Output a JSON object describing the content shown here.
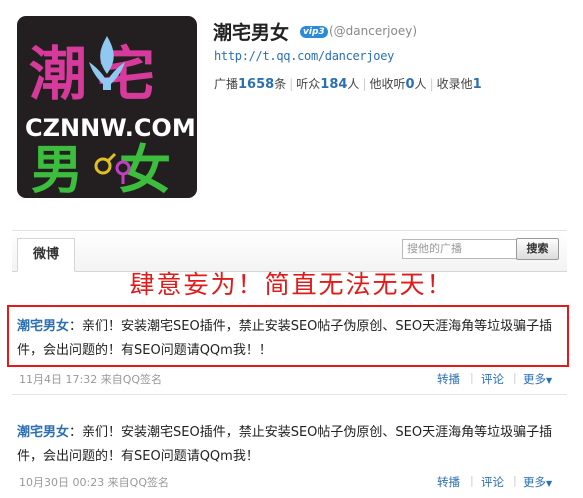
{
  "profile": {
    "name": "潮宅男女",
    "vip_badge": "vip3",
    "handle": "(@dancerjoey)",
    "url": "http://t.qq.com/dancerjoey",
    "avatar": {
      "line1": "潮宅",
      "line2": "CZNNW.COM",
      "line3": "男女"
    },
    "stats": [
      {
        "label": "广播",
        "value": "1658",
        "unit": "条"
      },
      {
        "label": "听众",
        "value": "184",
        "unit": "人"
      },
      {
        "label": "他收听",
        "value": "0",
        "unit": "人"
      },
      {
        "label": "收录他",
        "value": "1",
        "unit": ""
      }
    ]
  },
  "tabs": {
    "active": "微博"
  },
  "search": {
    "placeholder": "搜他的广播",
    "button_label": "搜索"
  },
  "annotation": {
    "caption": "肆意妄为！简直无法无天！",
    "color": "#e21a1a"
  },
  "posts": [
    {
      "author": "潮宅男女",
      "text": "：亲们！安装潮宅SEO插件，禁止安装SEO帖子伪原创、SEO天涯海角等垃圾骗子插件，会出问题的！有SEO问题请QQm我！！",
      "time": "11月4日  17:32 来自QQ签名",
      "repost_label": "转播",
      "comment_label": "评论",
      "more_label": "更多"
    },
    {
      "author": "潮宅男女",
      "text": "：亲们！安装潮宅SEO插件，禁止安装SEO帖子伪原创、SEO天涯海角等垃圾骗子插件，会出问题的！有SEO问题请QQm我！",
      "time": "10月30日  00:23 来自QQ签名",
      "repost_label": "转播",
      "comment_label": "评论",
      "more_label": "更多"
    }
  ],
  "colors": {
    "link": "#2b6fb5",
    "annotation": "#e21a1a"
  }
}
